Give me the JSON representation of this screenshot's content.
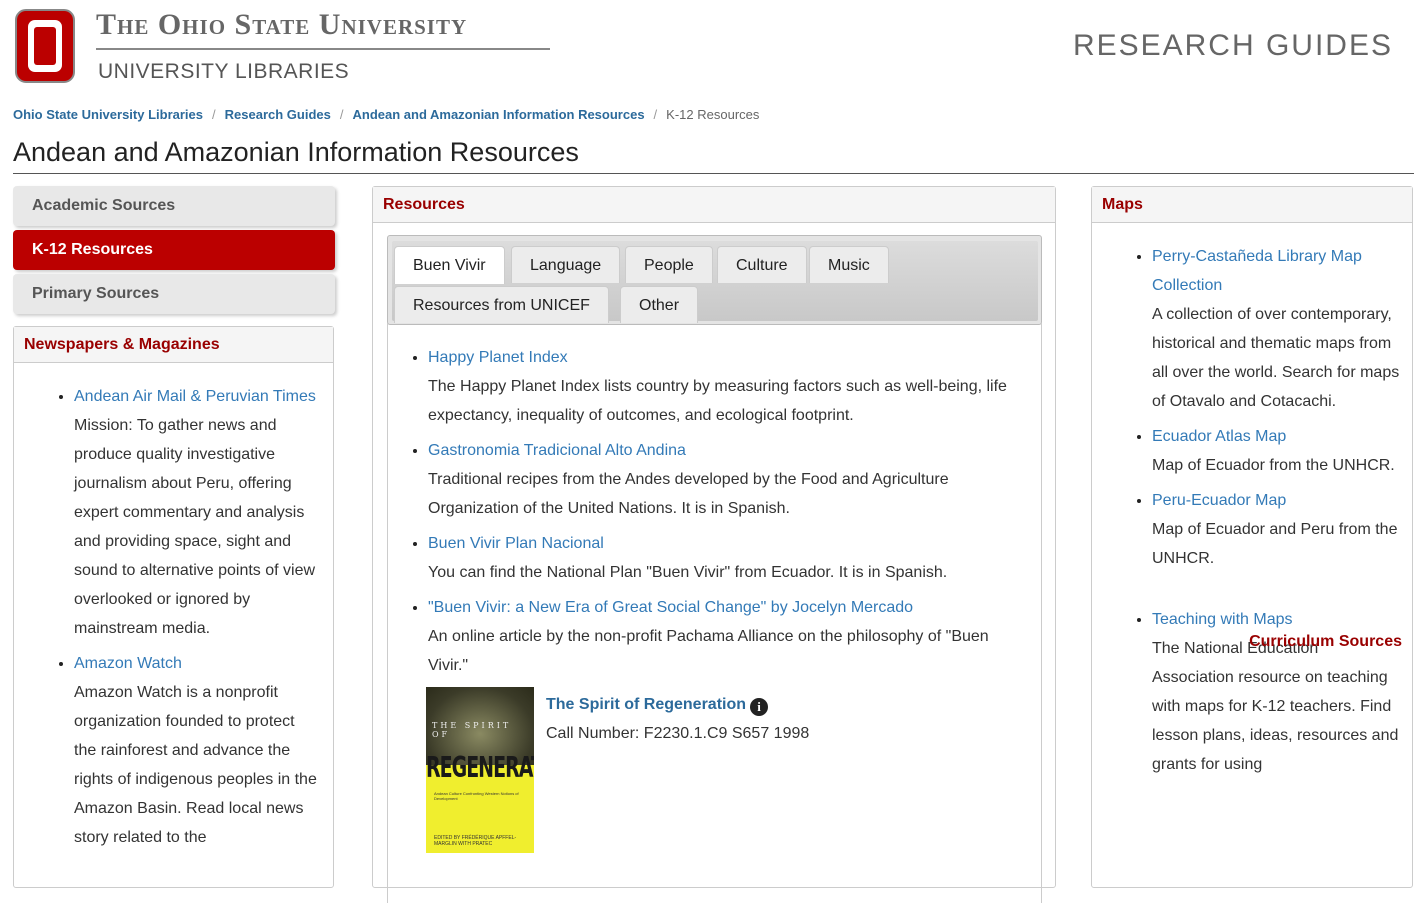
{
  "header": {
    "university_name": "The Ohio State University",
    "libraries_label": "UNIVERSITY LIBRARIES",
    "site_title": "RESEARCH GUIDES",
    "brand_color": "#bb0000"
  },
  "breadcrumb": [
    {
      "label": "Ohio State University Libraries"
    },
    {
      "label": "Research Guides"
    },
    {
      "label": "Andean and Amazonian Information Resources"
    },
    {
      "label": "K-12 Resources"
    }
  ],
  "page_title": "Andean and Amazonian Information Resources",
  "nav": [
    {
      "label": "Academic Sources"
    },
    {
      "label": "K-12 Resources"
    },
    {
      "label": "Primary Sources"
    }
  ],
  "newspapers": {
    "heading": "Newspapers & Magazines",
    "items": [
      {
        "title": "Andean Air Mail & Peruvian Times",
        "description": "Mission: To gather news and produce quality investigative journalism about Peru, offering expert commentary and analysis and providing space, sight and sound to alternative points of view overlooked or ignored by mainstream media."
      },
      {
        "title": "Amazon Watch",
        "description": "Amazon Watch is a nonprofit organization founded to protect the rainforest and advance the rights of indigenous peoples in the Amazon Basin. Read local news story related to the"
      }
    ]
  },
  "resources": {
    "heading": "Resources",
    "tabs": [
      "Buen Vivir",
      "Language",
      "People",
      "Culture",
      "Music",
      "Resources from UNICEF",
      "Other"
    ],
    "items": [
      {
        "title": "Happy Planet Index",
        "description": "The Happy Planet Index lists country by measuring factors such as well-being, life expectancy, inequality of outcomes, and ecological footprint."
      },
      {
        "title": "Gastronomia Tradicional Alto Andina",
        "description": "Traditional recipes from the Andes developed by the Food and Agriculture Organization of the United Nations. It is in Spanish."
      },
      {
        "title": "Buen Vivir Plan Nacional",
        "description": "You can find the National Plan \"Buen Vivir\" from Ecuador. It is in Spanish."
      },
      {
        "title": "\"Buen Vivir: a New Era of Great Social Change\" by Jocelyn Mercado",
        "description": "An online article by the non-profit Pachama Alliance on the philosophy of \"Buen Vivir.\""
      }
    ],
    "book": {
      "title": "The Spirit of Regeneration",
      "call_number": "Call Number: F2230.1.C9 S657 1998",
      "cover_text": "REGENERATION",
      "cover_top": "THE SPIRIT OF",
      "cover_subtitle": "Andean Culture Confronting Western Notions of Development",
      "cover_author": "EDITED BY FRÉDÉRIQUE APFFEL-MARGLIN WITH PRATEC"
    }
  },
  "maps": {
    "heading": "Maps",
    "items": [
      {
        "title": "Perry-Castañeda Library Map Collection",
        "description": "A collection of over contemporary, historical and thematic maps from all over the world. Search for maps of Otavalo and Cotacachi."
      },
      {
        "title": "Ecuador Atlas Map",
        "description": "Map of Ecuador from the UNHCR."
      },
      {
        "title": "Peru-Ecuador Map",
        "description": "Map of Ecuador and Peru from the UNHCR."
      }
    ],
    "subheading": "Curriculum Sources",
    "items2": [
      {
        "title": "Teaching with Maps",
        "description": "The National Education Association resource on teaching with maps for K-12 teachers. Find lesson plans, ideas, resources and grants for using"
      }
    ]
  }
}
